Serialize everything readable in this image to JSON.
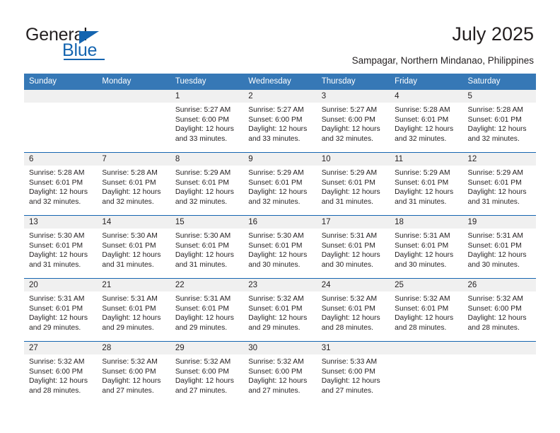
{
  "brand": {
    "name_part1": "General",
    "name_part2": "Blue"
  },
  "header": {
    "title": "July 2025",
    "location": "Sampagar, Northern Mindanao, Philippines"
  },
  "calendar": {
    "weekday_headers": [
      "Sunday",
      "Monday",
      "Tuesday",
      "Wednesday",
      "Thursday",
      "Friday",
      "Saturday"
    ],
    "accent_header_color": "#3678b6",
    "accent_rule_color": "#1565b0",
    "daynum_band_color": "#f0f0f0",
    "weeks": [
      [
        {
          "day": "",
          "empty": true,
          "sunrise": "",
          "sunset": "",
          "daylight1": "",
          "daylight2": ""
        },
        {
          "day": "",
          "empty": true,
          "sunrise": "",
          "sunset": "",
          "daylight1": "",
          "daylight2": ""
        },
        {
          "day": "1",
          "empty": false,
          "sunrise": "Sunrise: 5:27 AM",
          "sunset": "Sunset: 6:00 PM",
          "daylight1": "Daylight: 12 hours",
          "daylight2": "and 33 minutes."
        },
        {
          "day": "2",
          "empty": false,
          "sunrise": "Sunrise: 5:27 AM",
          "sunset": "Sunset: 6:00 PM",
          "daylight1": "Daylight: 12 hours",
          "daylight2": "and 33 minutes."
        },
        {
          "day": "3",
          "empty": false,
          "sunrise": "Sunrise: 5:27 AM",
          "sunset": "Sunset: 6:00 PM",
          "daylight1": "Daylight: 12 hours",
          "daylight2": "and 32 minutes."
        },
        {
          "day": "4",
          "empty": false,
          "sunrise": "Sunrise: 5:28 AM",
          "sunset": "Sunset: 6:01 PM",
          "daylight1": "Daylight: 12 hours",
          "daylight2": "and 32 minutes."
        },
        {
          "day": "5",
          "empty": false,
          "sunrise": "Sunrise: 5:28 AM",
          "sunset": "Sunset: 6:01 PM",
          "daylight1": "Daylight: 12 hours",
          "daylight2": "and 32 minutes."
        }
      ],
      [
        {
          "day": "6",
          "empty": false,
          "sunrise": "Sunrise: 5:28 AM",
          "sunset": "Sunset: 6:01 PM",
          "daylight1": "Daylight: 12 hours",
          "daylight2": "and 32 minutes."
        },
        {
          "day": "7",
          "empty": false,
          "sunrise": "Sunrise: 5:28 AM",
          "sunset": "Sunset: 6:01 PM",
          "daylight1": "Daylight: 12 hours",
          "daylight2": "and 32 minutes."
        },
        {
          "day": "8",
          "empty": false,
          "sunrise": "Sunrise: 5:29 AM",
          "sunset": "Sunset: 6:01 PM",
          "daylight1": "Daylight: 12 hours",
          "daylight2": "and 32 minutes."
        },
        {
          "day": "9",
          "empty": false,
          "sunrise": "Sunrise: 5:29 AM",
          "sunset": "Sunset: 6:01 PM",
          "daylight1": "Daylight: 12 hours",
          "daylight2": "and 32 minutes."
        },
        {
          "day": "10",
          "empty": false,
          "sunrise": "Sunrise: 5:29 AM",
          "sunset": "Sunset: 6:01 PM",
          "daylight1": "Daylight: 12 hours",
          "daylight2": "and 31 minutes."
        },
        {
          "day": "11",
          "empty": false,
          "sunrise": "Sunrise: 5:29 AM",
          "sunset": "Sunset: 6:01 PM",
          "daylight1": "Daylight: 12 hours",
          "daylight2": "and 31 minutes."
        },
        {
          "day": "12",
          "empty": false,
          "sunrise": "Sunrise: 5:29 AM",
          "sunset": "Sunset: 6:01 PM",
          "daylight1": "Daylight: 12 hours",
          "daylight2": "and 31 minutes."
        }
      ],
      [
        {
          "day": "13",
          "empty": false,
          "sunrise": "Sunrise: 5:30 AM",
          "sunset": "Sunset: 6:01 PM",
          "daylight1": "Daylight: 12 hours",
          "daylight2": "and 31 minutes."
        },
        {
          "day": "14",
          "empty": false,
          "sunrise": "Sunrise: 5:30 AM",
          "sunset": "Sunset: 6:01 PM",
          "daylight1": "Daylight: 12 hours",
          "daylight2": "and 31 minutes."
        },
        {
          "day": "15",
          "empty": false,
          "sunrise": "Sunrise: 5:30 AM",
          "sunset": "Sunset: 6:01 PM",
          "daylight1": "Daylight: 12 hours",
          "daylight2": "and 31 minutes."
        },
        {
          "day": "16",
          "empty": false,
          "sunrise": "Sunrise: 5:30 AM",
          "sunset": "Sunset: 6:01 PM",
          "daylight1": "Daylight: 12 hours",
          "daylight2": "and 30 minutes."
        },
        {
          "day": "17",
          "empty": false,
          "sunrise": "Sunrise: 5:31 AM",
          "sunset": "Sunset: 6:01 PM",
          "daylight1": "Daylight: 12 hours",
          "daylight2": "and 30 minutes."
        },
        {
          "day": "18",
          "empty": false,
          "sunrise": "Sunrise: 5:31 AM",
          "sunset": "Sunset: 6:01 PM",
          "daylight1": "Daylight: 12 hours",
          "daylight2": "and 30 minutes."
        },
        {
          "day": "19",
          "empty": false,
          "sunrise": "Sunrise: 5:31 AM",
          "sunset": "Sunset: 6:01 PM",
          "daylight1": "Daylight: 12 hours",
          "daylight2": "and 30 minutes."
        }
      ],
      [
        {
          "day": "20",
          "empty": false,
          "sunrise": "Sunrise: 5:31 AM",
          "sunset": "Sunset: 6:01 PM",
          "daylight1": "Daylight: 12 hours",
          "daylight2": "and 29 minutes."
        },
        {
          "day": "21",
          "empty": false,
          "sunrise": "Sunrise: 5:31 AM",
          "sunset": "Sunset: 6:01 PM",
          "daylight1": "Daylight: 12 hours",
          "daylight2": "and 29 minutes."
        },
        {
          "day": "22",
          "empty": false,
          "sunrise": "Sunrise: 5:31 AM",
          "sunset": "Sunset: 6:01 PM",
          "daylight1": "Daylight: 12 hours",
          "daylight2": "and 29 minutes."
        },
        {
          "day": "23",
          "empty": false,
          "sunrise": "Sunrise: 5:32 AM",
          "sunset": "Sunset: 6:01 PM",
          "daylight1": "Daylight: 12 hours",
          "daylight2": "and 29 minutes."
        },
        {
          "day": "24",
          "empty": false,
          "sunrise": "Sunrise: 5:32 AM",
          "sunset": "Sunset: 6:01 PM",
          "daylight1": "Daylight: 12 hours",
          "daylight2": "and 28 minutes."
        },
        {
          "day": "25",
          "empty": false,
          "sunrise": "Sunrise: 5:32 AM",
          "sunset": "Sunset: 6:01 PM",
          "daylight1": "Daylight: 12 hours",
          "daylight2": "and 28 minutes."
        },
        {
          "day": "26",
          "empty": false,
          "sunrise": "Sunrise: 5:32 AM",
          "sunset": "Sunset: 6:00 PM",
          "daylight1": "Daylight: 12 hours",
          "daylight2": "and 28 minutes."
        }
      ],
      [
        {
          "day": "27",
          "empty": false,
          "sunrise": "Sunrise: 5:32 AM",
          "sunset": "Sunset: 6:00 PM",
          "daylight1": "Daylight: 12 hours",
          "daylight2": "and 28 minutes."
        },
        {
          "day": "28",
          "empty": false,
          "sunrise": "Sunrise: 5:32 AM",
          "sunset": "Sunset: 6:00 PM",
          "daylight1": "Daylight: 12 hours",
          "daylight2": "and 27 minutes."
        },
        {
          "day": "29",
          "empty": false,
          "sunrise": "Sunrise: 5:32 AM",
          "sunset": "Sunset: 6:00 PM",
          "daylight1": "Daylight: 12 hours",
          "daylight2": "and 27 minutes."
        },
        {
          "day": "30",
          "empty": false,
          "sunrise": "Sunrise: 5:32 AM",
          "sunset": "Sunset: 6:00 PM",
          "daylight1": "Daylight: 12 hours",
          "daylight2": "and 27 minutes."
        },
        {
          "day": "31",
          "empty": false,
          "sunrise": "Sunrise: 5:33 AM",
          "sunset": "Sunset: 6:00 PM",
          "daylight1": "Daylight: 12 hours",
          "daylight2": "and 27 minutes."
        },
        {
          "day": "",
          "empty": true,
          "sunrise": "",
          "sunset": "",
          "daylight1": "",
          "daylight2": ""
        },
        {
          "day": "",
          "empty": true,
          "sunrise": "",
          "sunset": "",
          "daylight1": "",
          "daylight2": ""
        }
      ]
    ]
  }
}
